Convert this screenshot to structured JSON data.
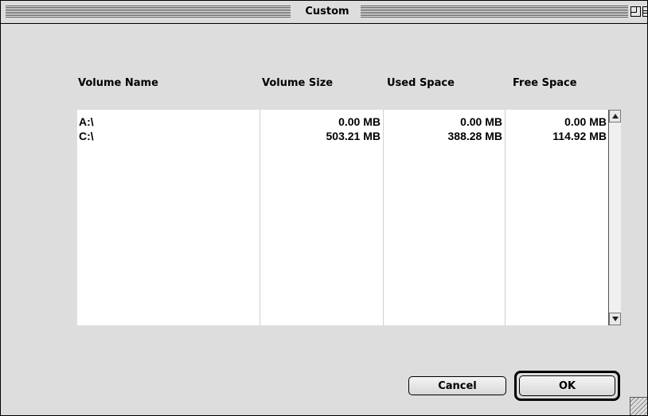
{
  "window": {
    "title": "Custom"
  },
  "columns": {
    "volume_name": "Volume Name",
    "volume_size": "Volume Size",
    "used_space": "Used Space",
    "free_space": "Free Space"
  },
  "volumes": [
    {
      "name": "A:\\",
      "size": "0.00 MB",
      "used": "0.00 MB",
      "free": "0.00 MB"
    },
    {
      "name": "C:\\",
      "size": "503.21 MB",
      "used": "388.28 MB",
      "free": "114.92 MB"
    }
  ],
  "buttons": {
    "cancel": "Cancel",
    "ok": "OK"
  },
  "icons": {
    "scroll_up": "scroll-up-arrow-icon",
    "scroll_down": "scroll-down-arrow-icon",
    "zoom": "zoom-box-icon",
    "collapse": "collapse-box-icon",
    "grow": "grow-box-icon"
  }
}
